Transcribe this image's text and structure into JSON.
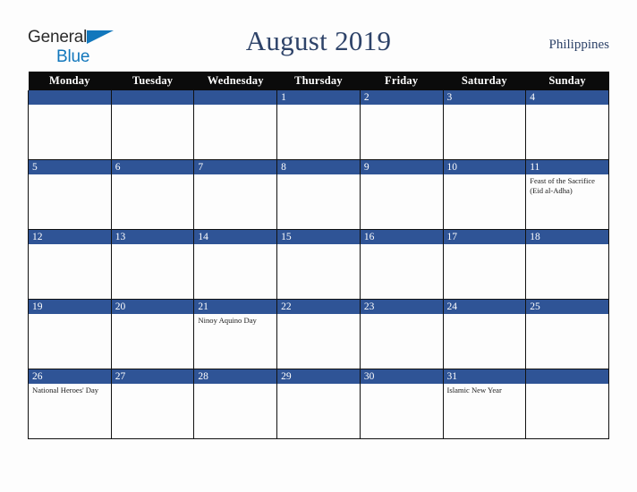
{
  "brand": {
    "name_part1": "General",
    "name_part2": "Blue",
    "triangle_icon": "triangle-icon",
    "colors": {
      "dark": "#2b2b2b",
      "blue": "#1277bc"
    }
  },
  "header": {
    "title": "August 2019",
    "region": "Philippines",
    "title_color": "#2e4369"
  },
  "calendar": {
    "accent_color": "#2f5496",
    "header_bg": "#0b0b0b",
    "weekday_headers": [
      "Monday",
      "Tuesday",
      "Wednesday",
      "Thursday",
      "Friday",
      "Saturday",
      "Sunday"
    ],
    "weeks": [
      [
        {
          "day": "",
          "event": ""
        },
        {
          "day": "",
          "event": ""
        },
        {
          "day": "",
          "event": ""
        },
        {
          "day": "1",
          "event": ""
        },
        {
          "day": "2",
          "event": ""
        },
        {
          "day": "3",
          "event": ""
        },
        {
          "day": "4",
          "event": ""
        }
      ],
      [
        {
          "day": "5",
          "event": ""
        },
        {
          "day": "6",
          "event": ""
        },
        {
          "day": "7",
          "event": ""
        },
        {
          "day": "8",
          "event": ""
        },
        {
          "day": "9",
          "event": ""
        },
        {
          "day": "10",
          "event": ""
        },
        {
          "day": "11",
          "event": "Feast of the Sacrifice (Eid al-Adha)"
        }
      ],
      [
        {
          "day": "12",
          "event": ""
        },
        {
          "day": "13",
          "event": ""
        },
        {
          "day": "14",
          "event": ""
        },
        {
          "day": "15",
          "event": ""
        },
        {
          "day": "16",
          "event": ""
        },
        {
          "day": "17",
          "event": ""
        },
        {
          "day": "18",
          "event": ""
        }
      ],
      [
        {
          "day": "19",
          "event": ""
        },
        {
          "day": "20",
          "event": ""
        },
        {
          "day": "21",
          "event": "Ninoy Aquino Day"
        },
        {
          "day": "22",
          "event": ""
        },
        {
          "day": "23",
          "event": ""
        },
        {
          "day": "24",
          "event": ""
        },
        {
          "day": "25",
          "event": ""
        }
      ],
      [
        {
          "day": "26",
          "event": "National Heroes' Day"
        },
        {
          "day": "27",
          "event": ""
        },
        {
          "day": "28",
          "event": ""
        },
        {
          "day": "29",
          "event": ""
        },
        {
          "day": "30",
          "event": ""
        },
        {
          "day": "31",
          "event": "Islamic New Year"
        },
        {
          "day": "",
          "event": ""
        }
      ]
    ]
  }
}
